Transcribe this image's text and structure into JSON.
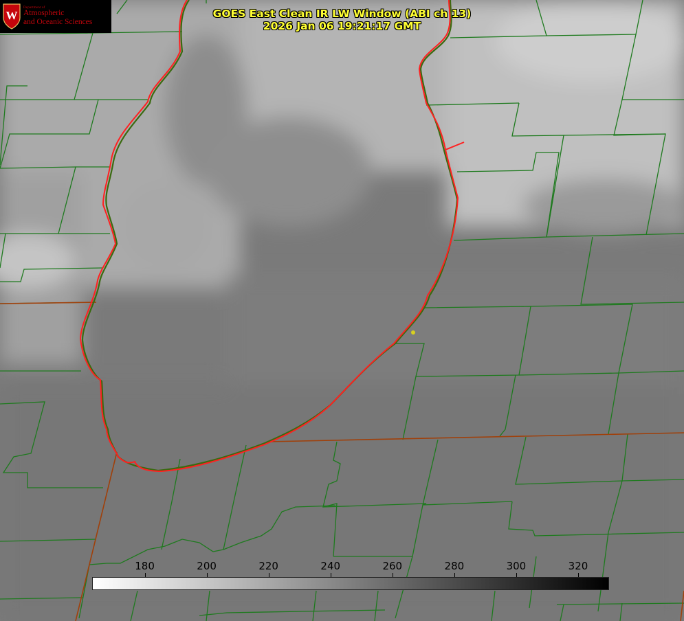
{
  "logo": {
    "department": "Department of",
    "line1": "Atmospheric",
    "line2": "and Oceanic Sciences",
    "crest_letter": "W"
  },
  "title": {
    "line1": "GOES East Clean IR LW Window (ABI ch 13)",
    "line2": "2026 Jan 06 19:21:17 GMT"
  },
  "colorbar": {
    "min": 163,
    "max": 330,
    "ticks": [
      "180",
      "200",
      "220",
      "240",
      "260",
      "280",
      "300",
      "320"
    ],
    "tick_values": [
      180,
      200,
      220,
      240,
      260,
      280,
      300,
      320
    ],
    "color_low": "#ffffff",
    "color_high": "#000000"
  },
  "colors": {
    "county_lines": "#1e7a1e",
    "lake_outline": "#ff2020",
    "state_lines": "#a0400a",
    "title_text": "#ffff33",
    "marker": "#d8d020"
  }
}
